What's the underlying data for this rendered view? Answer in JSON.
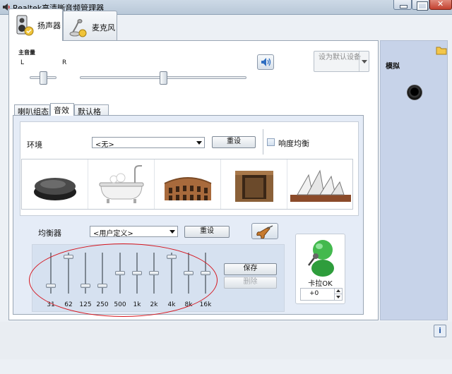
{
  "window": {
    "title": "Realtek高清晰音频管理器"
  },
  "device_tabs": [
    {
      "label": "扬声器",
      "active": true,
      "icon": "speaker-device-icon"
    },
    {
      "label": "麦克风",
      "active": false,
      "icon": "microphone-device-icon"
    }
  ],
  "volume": {
    "label": "主音量",
    "left_label": "L",
    "right_label": "R",
    "balance": 0.5,
    "level": 0.5,
    "icon": "speaker-volume-icon"
  },
  "default_device": {
    "label": "设为默认设备"
  },
  "inner_tabs": [
    {
      "label": "喇叭组态",
      "active": false
    },
    {
      "label": "音效",
      "active": true
    },
    {
      "label": "默认格式",
      "active": false
    }
  ],
  "environment": {
    "label": "环境",
    "selected": "<无>",
    "reset_label": "重设",
    "loudness_label": "响度均衡",
    "loudness_checked": false,
    "presets": [
      "stone-icon",
      "bathtub-icon",
      "colosseum-icon",
      "sewer-pipe-icon",
      "opera-house-icon"
    ]
  },
  "equalizer": {
    "label": "均衡器",
    "selected": "<用户定义>",
    "reset_label": "重设",
    "save_label": "保存",
    "delete_label": "删除",
    "guitar_icon": "guitar-icon",
    "bands": [
      {
        "freq": "31",
        "level": 0.15
      },
      {
        "freq": "62",
        "level": 0.95
      },
      {
        "freq": "125",
        "level": 0.15
      },
      {
        "freq": "250",
        "level": 0.15
      },
      {
        "freq": "500",
        "level": 0.5
      },
      {
        "freq": "1k",
        "level": 0.5
      },
      {
        "freq": "2k",
        "level": 0.5
      },
      {
        "freq": "4k",
        "level": 0.95
      },
      {
        "freq": "8k",
        "level": 0.5
      },
      {
        "freq": "16k",
        "level": 0.5
      }
    ],
    "annotation_color": "#d5141d"
  },
  "karaoke": {
    "label": "卡拉OK",
    "value": "+0",
    "icon": "karaoke-singer-icon"
  },
  "side": {
    "label": "模拟",
    "folder_icon": "folder-icon",
    "jack_icon": "audio-jack-icon",
    "info_icon": "info-icon"
  }
}
